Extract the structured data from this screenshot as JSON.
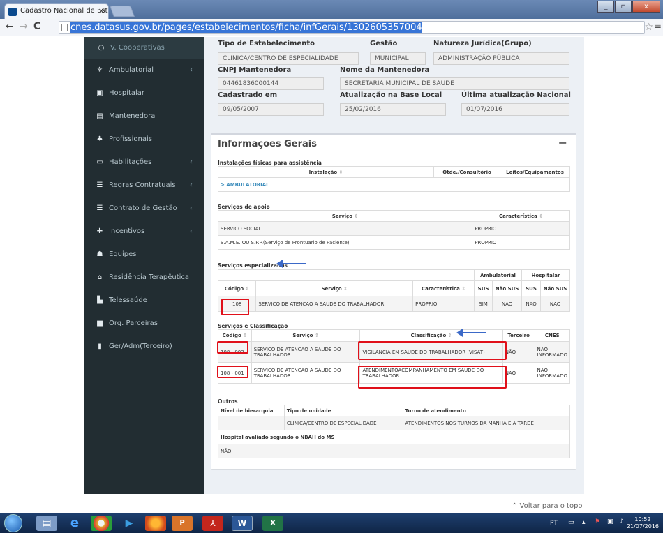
{
  "browser": {
    "tab_title": "Cadastro Nacional de Esta",
    "tab_close": "×",
    "url_domain": "cnes.datasus.gov.br",
    "url_path": "/pages/estabelecimentos/ficha/infGerais/1302605357004",
    "back": "←",
    "forward": "→",
    "reload": "C",
    "star": "☆",
    "menu": "≡",
    "win_min": "_",
    "win_max": "▫",
    "win_close": "x"
  },
  "sidebar": {
    "items": [
      {
        "label": "V. Cooperativas",
        "icon": "○"
      },
      {
        "label": "Ambulatorial",
        "icon": "♆",
        "chevron": "‹"
      },
      {
        "label": "Hospitalar",
        "icon": "▣"
      },
      {
        "label": "Mantenedora",
        "icon": "▤"
      },
      {
        "label": "Profissionais",
        "icon": "♣"
      },
      {
        "label": "Habilitações",
        "icon": "▭",
        "chevron": "‹"
      },
      {
        "label": "Regras Contratuais",
        "icon": "☰",
        "chevron": "‹"
      },
      {
        "label": "Contrato de Gestão",
        "icon": "☰",
        "chevron": "‹"
      },
      {
        "label": "Incentivos",
        "icon": "✚",
        "chevron": "‹"
      },
      {
        "label": "Equipes",
        "icon": "☗"
      },
      {
        "label": "Residência Terapêutica",
        "icon": "⌂"
      },
      {
        "label": "Telessaúde",
        "icon": "▙"
      },
      {
        "label": "Org. Parceiras",
        "icon": "▆"
      },
      {
        "label": "Ger/Adm(Terceiro)",
        "icon": "▮"
      }
    ]
  },
  "top_fields": {
    "tipo_estab_label": "Tipo de Estabelecimento",
    "tipo_estab_value": "CLINICA/CENTRO DE ESPECIALIDADE",
    "gestao_label": "Gestão",
    "gestao_value": "MUNICIPAL",
    "natureza_label": "Natureza Jurídica(Grupo)",
    "natureza_value": "ADMINISTRAÇÃO PÚBLICA",
    "cnpj_label": "CNPJ Mantenedora",
    "cnpj_value": "04461836000144",
    "nome_mant_label": "Nome da Mantenedora",
    "nome_mant_value": "SECRETARIA MUNICIPAL DE SAUDE",
    "cadastrado_label": "Cadastrado em",
    "cadastrado_value": "09/05/2007",
    "atualizacao_label": "Atualização na Base Local",
    "atualizacao_value": "25/02/2016",
    "ultima_label": "Última atualização Nacional",
    "ultima_value": "01/07/2016"
  },
  "info_gerais": {
    "title": "Informações Gerais",
    "collapse": "−",
    "instalacoes": {
      "title": "Instalações físicas para assistência",
      "headers": [
        "Instalação",
        "Qtde./Consultório",
        "Leitos/Equipamentos"
      ],
      "row": "> AMBULATORIAL"
    },
    "apoio": {
      "title": "Serviços de apoio",
      "headers": [
        "Serviço",
        "Característica"
      ],
      "rows": [
        [
          "SERVICO SOCIAL",
          "PROPRIO"
        ],
        [
          "S.A.M.E. OU S.P.P.(Serviço de Prontuario de Paciente)",
          "PROPRIO"
        ]
      ]
    },
    "especializados": {
      "title": "Serviços especializados",
      "group_headers": [
        "Ambulatorial",
        "Hospitalar"
      ],
      "headers": [
        "Código",
        "Serviço",
        "Característica",
        "SUS",
        "Não SUS",
        "SUS",
        "Não SUS"
      ],
      "rows": [
        [
          "108",
          "SERVICO DE ATENCAO A SAUDE DO TRABALHADOR",
          "PROPRIO",
          "SIM",
          "NÃO",
          "NÃO",
          "NÃO"
        ]
      ]
    },
    "classificacao": {
      "title": "Serviços e Classificação",
      "headers": [
        "Código",
        "Serviço",
        "Classificação",
        "Terceiro",
        "CNES"
      ],
      "rows": [
        [
          "108 - 003",
          "SERVICO DE ATENCAO A SAUDE DO TRABALHADOR",
          "VIGILANCIA EM SAUDE DO TRABALHADOR (VISAT)",
          "NÃO",
          "NAO INFORMADO"
        ],
        [
          "108 - 001",
          "SERVICO DE ATENCAO A SAUDE DO TRABALHADOR",
          "ATENDIMENTOACOMPANHAMENTO EM SAUDE DO TRABALHADOR",
          "NÃO",
          "NAO INFORMADO"
        ]
      ]
    },
    "outros": {
      "title": "Outros",
      "headers": [
        "Nível de hierarquia",
        "Tipo de unidade",
        "Turno de atendimento"
      ],
      "row": [
        "",
        "CLINICA/CENTRO DE ESPECIALIDADE",
        "ATENDIMENTOS NOS TURNOS DA MANHA E A TARDE"
      ],
      "nbah_label": "Hospital avaliado segundo o NBAH do MS",
      "nbah_value": "NÃO"
    }
  },
  "footer": {
    "back_to_top": "⌃ Voltar para o topo"
  },
  "taskbar": {
    "lang": "PT",
    "time": "10:52",
    "date": "21/07/2016"
  },
  "colors": {
    "sidebar_bg": "#222d32",
    "highlight_red": "#e0101a",
    "arrow_blue": "#3b69c8"
  }
}
